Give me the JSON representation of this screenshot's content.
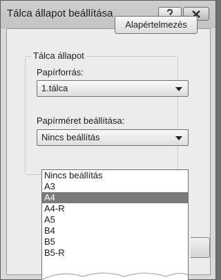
{
  "window": {
    "title": "Tálca állapot beállítása"
  },
  "icons": {
    "help": "help-icon",
    "close": "close-icon"
  },
  "default_button": {
    "label": "Alapértelmezés"
  },
  "group": {
    "label": "Tálca állapot",
    "paper_source": {
      "label": "Papírforrás:",
      "value": "1.tálca"
    },
    "paper_size": {
      "label": "Papírméret beállítása:",
      "value": "Nincs beállítás"
    }
  },
  "dropdown": {
    "items": [
      "Nincs beállítás",
      "A3",
      "A4",
      "A4-R",
      "A5",
      "B4",
      "B5",
      "B5-R"
    ],
    "selected": "A4"
  }
}
